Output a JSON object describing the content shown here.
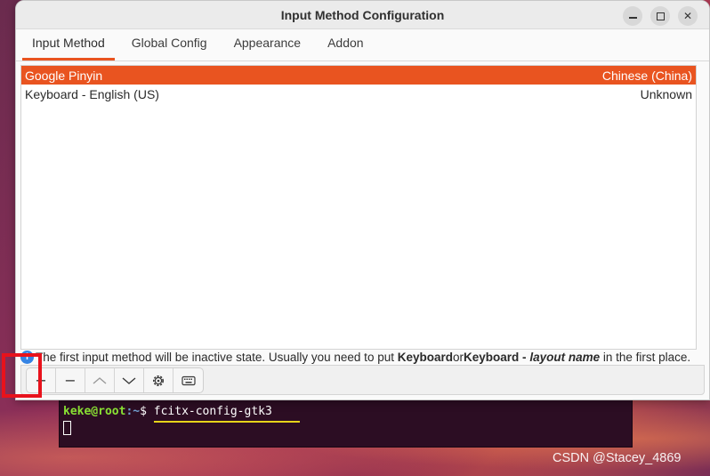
{
  "window": {
    "title": "Input Method Configuration"
  },
  "tabs": [
    {
      "label": "Input Method",
      "active": true
    },
    {
      "label": "Global Config",
      "active": false
    },
    {
      "label": "Appearance",
      "active": false
    },
    {
      "label": "Addon",
      "active": false
    }
  ],
  "input_methods": [
    {
      "name": "Google Pinyin",
      "language": "Chinese (China)",
      "selected": true
    },
    {
      "name": "Keyboard - English (US)",
      "language": "Unknown",
      "selected": false
    }
  ],
  "info": {
    "icon": "info-icon",
    "part1": "The first input method will be inactive state. Usually you need to put ",
    "bold1": "Keyboard",
    "part2": " or ",
    "bold2": "Keyboard - ",
    "italic": "layout name",
    "part3": " in the first place."
  },
  "toolbar": {
    "add": "+",
    "remove": "−",
    "move_up": "︿",
    "move_down": "﹀"
  },
  "terminal": {
    "user": "keke@root",
    "path": ":~",
    "prompt": "$ ",
    "command": "fcitx-config-gtk3"
  },
  "watermark": "CSDN @Stacey_4869",
  "colors": {
    "accent": "#e95420",
    "highlight_box": "#e8121c",
    "terminal_bg": "#2c0d23"
  }
}
